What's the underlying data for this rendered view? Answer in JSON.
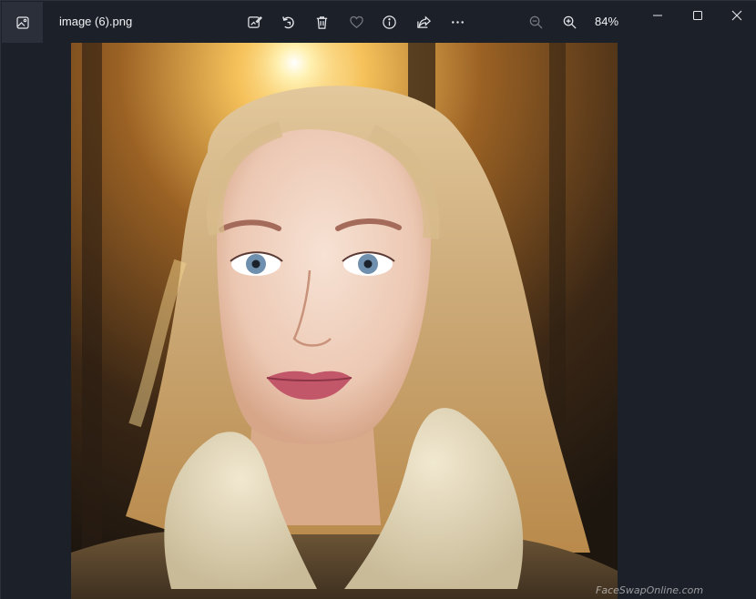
{
  "window": {
    "title": "image (6).png",
    "zoom": "84%"
  },
  "toolbar": {
    "buttons": [
      {
        "name": "edit-image-icon"
      },
      {
        "name": "rotate-icon"
      },
      {
        "name": "delete-icon"
      },
      {
        "name": "favorite-heart-icon"
      },
      {
        "name": "info-icon"
      },
      {
        "name": "share-icon"
      },
      {
        "name": "more-options-icon"
      }
    ],
    "zoom_out": {
      "name": "zoom-out-icon"
    },
    "zoom_in": {
      "name": "zoom-in-icon"
    }
  },
  "window_controls": [
    "minimize",
    "maximize",
    "close"
  ],
  "image": {
    "watermark": "FaceSwapOnline.com"
  },
  "colors": {
    "background": "#1c2029",
    "icon": "#e6e8ec"
  }
}
